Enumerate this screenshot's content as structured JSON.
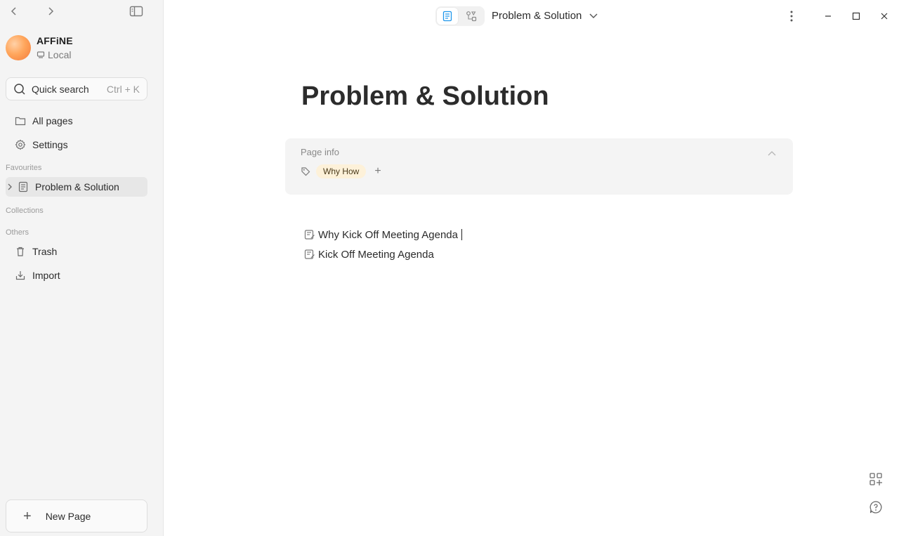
{
  "sidebar": {
    "workspace": {
      "name": "AFFiNE",
      "location": "Local"
    },
    "search": {
      "label": "Quick search",
      "shortcut": "Ctrl + K"
    },
    "nav": {
      "all_pages": "All pages",
      "settings": "Settings"
    },
    "sections": {
      "favourites": "Favourites",
      "collections": "Collections",
      "others": "Others"
    },
    "favourites": [
      {
        "label": "Problem & Solution"
      }
    ],
    "others": {
      "trash": "Trash",
      "import": "Import"
    },
    "new_page": "New Page"
  },
  "header": {
    "doc_title": "Problem & Solution",
    "mode": "page"
  },
  "document": {
    "title": "Problem & Solution",
    "page_info": {
      "label": "Page info",
      "tags": [
        "Why How"
      ]
    },
    "linked_pages": [
      {
        "label": "Why Kick Off Meeting Agenda"
      },
      {
        "label": "Kick Off Meeting Agenda"
      }
    ]
  },
  "colors": {
    "accent": "#1e96eb",
    "tag_bg": "#fdf1d9",
    "sidebar_bg": "#f4f4f4"
  }
}
